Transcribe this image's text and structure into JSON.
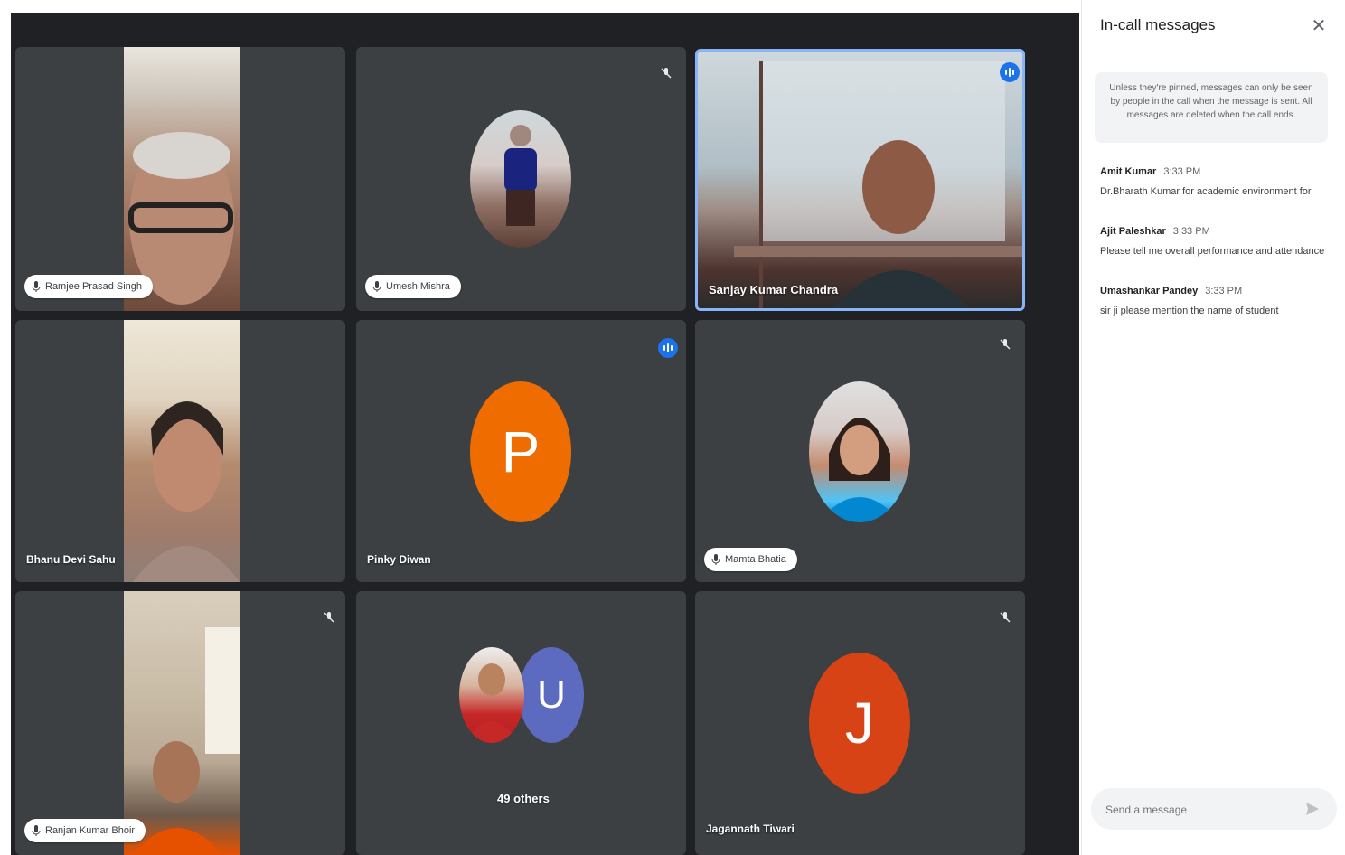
{
  "participants": [
    {
      "name": "Ramjee Prasad Singh"
    },
    {
      "name": "Umesh Mishra"
    },
    {
      "name": "Sanjay Kumar Chandra"
    },
    {
      "name": "Bhanu Devi Sahu"
    },
    {
      "name": "Pinky Diwan"
    },
    {
      "name": "Mamta Bhatia"
    },
    {
      "name": "Ranjan Kumar Bhoir"
    },
    {
      "name": "Jagannath Tiwari"
    }
  ],
  "avatars": {
    "pinky_letter": "P",
    "others_letter": "U",
    "jagannath_letter": "J"
  },
  "others_label": "49 others",
  "colors": {
    "meet_bg": "#202124",
    "tile_bg": "#3c4043",
    "active_border": "#8ab4f8",
    "speaking_blue": "#1a73e8",
    "avatar_orange": "#ef6c00",
    "avatar_red": "#d84315",
    "avatar_purple": "#5c6bc0"
  },
  "panel": {
    "title": "In-call messages",
    "close_icon": "close-icon",
    "notice": "Unless they're pinned, messages can only be seen by people in the call when the message is sent. All messages are deleted when the call ends.",
    "messages": [
      {
        "sender": "Amit Kumar",
        "time": "3:33 PM",
        "text": "Dr.Bharath Kumar for academic environment for"
      },
      {
        "sender": "Ajit Paleshkar",
        "time": "3:33 PM",
        "text": "Please tell me overall performance and attendance"
      },
      {
        "sender": "Umashankar Pandey",
        "time": "3:33 PM",
        "text": "sir ji please mention the name of student"
      }
    ],
    "composer_placeholder": "Send a message",
    "send_icon": "send-icon"
  }
}
